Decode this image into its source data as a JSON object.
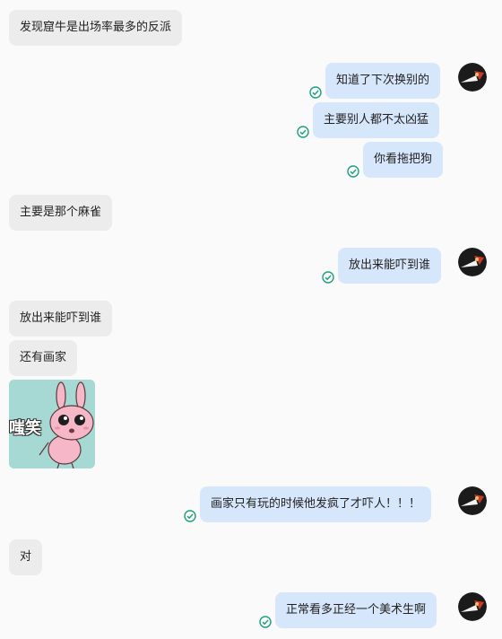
{
  "messages": [
    {
      "side": "in",
      "text": "发现窟牛是出场率最多的反派"
    },
    {
      "side": "out",
      "text": "知道了下次换别的"
    },
    {
      "side": "out",
      "text": "主要别人都不太凶猛"
    },
    {
      "side": "out",
      "text": "你看拖把狗"
    },
    {
      "side": "in",
      "text": "主要是那个麻雀"
    },
    {
      "side": "out",
      "text": "放出来能吓到谁"
    },
    {
      "side": "in",
      "text": "放出来能吓到谁"
    },
    {
      "side": "in",
      "text": "还有画家"
    },
    {
      "side": "in",
      "sticker_text": "嗤笑"
    },
    {
      "side": "out",
      "text": "画家只有玩的时候他发疯了才吓人！！！"
    },
    {
      "side": "in",
      "text": "对"
    },
    {
      "side": "out",
      "text": "正常看多正经一个美术生啊"
    }
  ],
  "colors": {
    "incoming_bubble": "#ececec",
    "outgoing_bubble": "#d6e6fb",
    "read_check": "#1aa07a",
    "sticker_bg": "#a6d8d4"
  },
  "icons": {
    "read_status": "check-circle-icon",
    "avatar": "avatar-icon"
  }
}
